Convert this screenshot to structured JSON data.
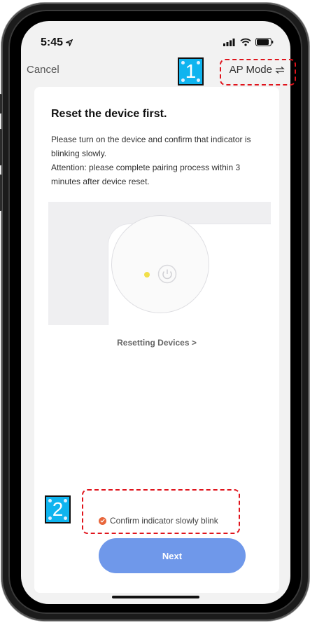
{
  "status_bar": {
    "time": "5:45"
  },
  "nav": {
    "cancel_label": "Cancel",
    "ap_mode_label": "AP Mode"
  },
  "card": {
    "title": "Reset the device first.",
    "description_line1": "Please turn on the device and confirm that indicator is blinking slowly.",
    "description_line2": "Attention: please complete pairing process within 3 minutes after device reset.",
    "resetting_link": "Resetting Devices >",
    "confirm_label": "Confirm indicator slowly blink",
    "next_label": "Next"
  },
  "annotations": {
    "badge_1": "1",
    "badge_2": "2"
  },
  "colors": {
    "accent_button": "#6f98ea",
    "check_dot": "#e8663b",
    "indicator_light": "#f1df4a",
    "annotation_border": "#e0141c",
    "badge_bg": "#0fb4ef"
  },
  "icons": [
    "location-arrow-icon",
    "signal-icon",
    "wifi-icon",
    "battery-icon",
    "switch-arrows-icon",
    "power-icon",
    "check-icon"
  ]
}
